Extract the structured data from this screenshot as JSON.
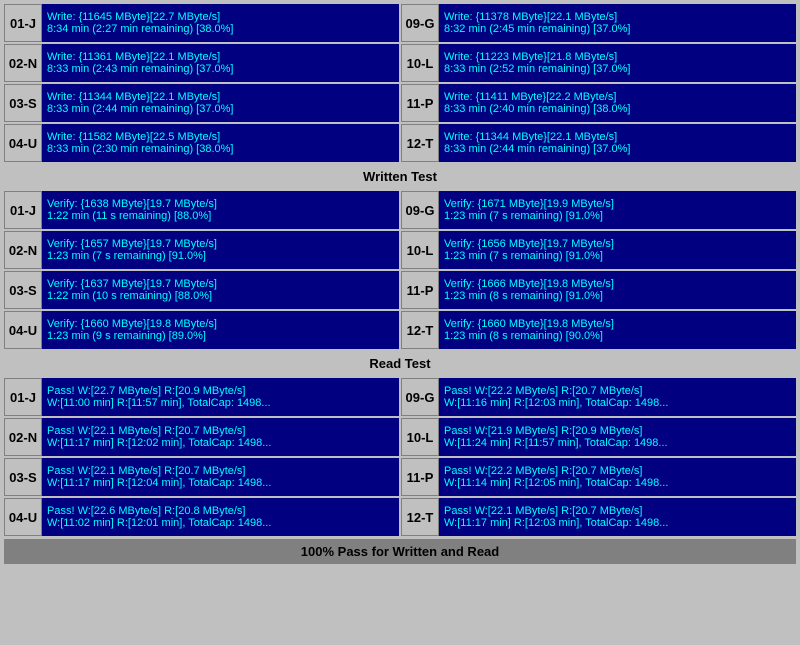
{
  "write_section": {
    "rows_left": [
      {
        "id": "01-J",
        "line1": "Write: {11645 MByte}[22.7 MByte/s]",
        "line2": "8:34 min (2:27 min remaining)  [38.0%]"
      },
      {
        "id": "02-N",
        "line1": "Write: {11361 MByte}[22.1 MByte/s]",
        "line2": "8:33 min (2:43 min remaining)  [37.0%]"
      },
      {
        "id": "03-S",
        "line1": "Write: {11344 MByte}[22.1 MByte/s]",
        "line2": "8:33 min (2:44 min remaining)  [37.0%]"
      },
      {
        "id": "04-U",
        "line1": "Write: {11582 MByte}[22.5 MByte/s]",
        "line2": "8:33 min (2:30 min remaining)  [38.0%]"
      }
    ],
    "rows_right": [
      {
        "id": "09-G",
        "line1": "Write: {11378 MByte}[22.1 MByte/s]",
        "line2": "8:32 min (2:45 min remaining)  [37.0%]"
      },
      {
        "id": "10-L",
        "line1": "Write: {11223 MByte}[21.8 MByte/s]",
        "line2": "8:33 min (2:52 min remaining)  [37.0%]"
      },
      {
        "id": "11-P",
        "line1": "Write: {11411 MByte}[22.2 MByte/s]",
        "line2": "8:33 min (2:40 min remaining)  [38.0%]"
      },
      {
        "id": "12-T",
        "line1": "Write: {11344 MByte}[22.1 MByte/s]",
        "line2": "8:33 min (2:44 min remaining)  [37.0%]"
      }
    ],
    "header": "Written Test"
  },
  "verify_section": {
    "rows_left": [
      {
        "id": "01-J",
        "line1": "Verify: {1638 MByte}[19.7 MByte/s]",
        "line2": "1:22 min (11 s remaining)   [88.0%]"
      },
      {
        "id": "02-N",
        "line1": "Verify: {1657 MByte}[19.7 MByte/s]",
        "line2": "1:23 min (7 s remaining)   [91.0%]"
      },
      {
        "id": "03-S",
        "line1": "Verify: {1637 MByte}[19.7 MByte/s]",
        "line2": "1:22 min (10 s remaining)   [88.0%]"
      },
      {
        "id": "04-U",
        "line1": "Verify: {1660 MByte}[19.8 MByte/s]",
        "line2": "1:23 min (9 s remaining)   [89.0%]"
      }
    ],
    "rows_right": [
      {
        "id": "09-G",
        "line1": "Verify: {1671 MByte}[19.9 MByte/s]",
        "line2": "1:23 min (7 s remaining)   [91.0%]"
      },
      {
        "id": "10-L",
        "line1": "Verify: {1656 MByte}[19.7 MByte/s]",
        "line2": "1:23 min (7 s remaining)   [91.0%]"
      },
      {
        "id": "11-P",
        "line1": "Verify: {1666 MByte}[19.8 MByte/s]",
        "line2": "1:23 min (8 s remaining)   [91.0%]"
      },
      {
        "id": "12-T",
        "line1": "Verify: {1660 MByte}[19.8 MByte/s]",
        "line2": "1:23 min (8 s remaining)   [90.0%]"
      }
    ],
    "header": "Read Test"
  },
  "pass_section": {
    "rows_left": [
      {
        "id": "01-J",
        "line1": "Pass! W:[22.7 MByte/s] R:[20.9 MByte/s]",
        "line2": "W:[11:00 min] R:[11:57 min], TotalCap: 1498..."
      },
      {
        "id": "02-N",
        "line1": "Pass! W:[22.1 MByte/s] R:[20.7 MByte/s]",
        "line2": "W:[11:17 min] R:[12:02 min], TotalCap: 1498..."
      },
      {
        "id": "03-S",
        "line1": "Pass! W:[22.1 MByte/s] R:[20.7 MByte/s]",
        "line2": "W:[11:17 min] R:[12:04 min], TotalCap: 1498..."
      },
      {
        "id": "04-U",
        "line1": "Pass! W:[22.6 MByte/s] R:[20.8 MByte/s]",
        "line2": "W:[11:02 min] R:[12:01 min], TotalCap: 1498..."
      }
    ],
    "rows_right": [
      {
        "id": "09-G",
        "line1": "Pass! W:[22.2 MByte/s] R:[20.7 MByte/s]",
        "line2": "W:[11:16 min] R:[12:03 min], TotalCap: 1498..."
      },
      {
        "id": "10-L",
        "line1": "Pass! W:[21.9 MByte/s] R:[20.9 MByte/s]",
        "line2": "W:[11:24 min] R:[11:57 min], TotalCap: 1498..."
      },
      {
        "id": "11-P",
        "line1": "Pass! W:[22.2 MByte/s] R:[20.7 MByte/s]",
        "line2": "W:[11:14 min] R:[12:05 min], TotalCap: 1498..."
      },
      {
        "id": "12-T",
        "line1": "Pass! W:[22.1 MByte/s] R:[20.7 MByte/s]",
        "line2": "W:[11:17 min] R:[12:03 min], TotalCap: 1498..."
      }
    ],
    "header": "Read Test"
  },
  "bottom_bar": "100% Pass for Written and Read"
}
